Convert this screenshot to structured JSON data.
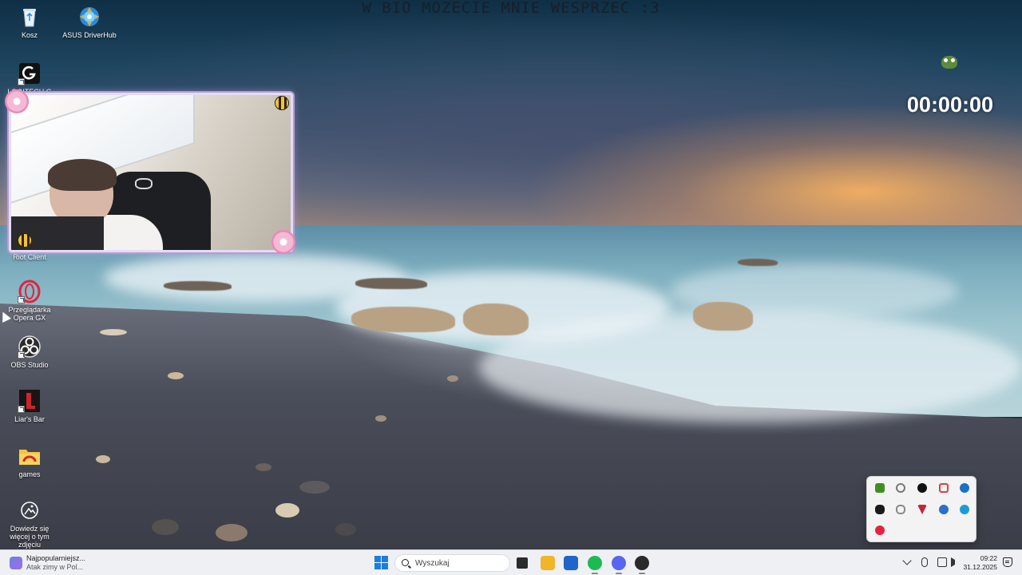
{
  "overlay": {
    "banner_text": "W BIO MOZECIE MNIE WESPRZEC :3",
    "timer": "00:00:00"
  },
  "desktop_icons": [
    {
      "label": "Kosz",
      "icon": "recycle-bin-icon"
    },
    {
      "label": "ASUS DriverHub",
      "icon": "asus-driverhub-icon"
    },
    {
      "label": "LOGITECH G HUB",
      "icon": "logitech-ghub-icon"
    },
    {
      "label": "Riot Client",
      "icon": "riot-client-icon"
    },
    {
      "label": "Przeglądarka Opera GX",
      "icon": "opera-gx-icon"
    },
    {
      "label": "OBS Studio",
      "icon": "obs-studio-icon"
    },
    {
      "label": "Liar's Bar",
      "icon": "liars-bar-icon"
    },
    {
      "label": "games",
      "icon": "folder-icon"
    },
    {
      "label": "Dowiedz się więcej o tym zdjęciu",
      "icon": "learn-about-picture-icon"
    }
  ],
  "taskbar": {
    "weather_title": "Najpopularniejsz...",
    "weather_subtitle": "Atak zimy w Pol...",
    "search_placeholder": "Wyszukaj",
    "time": "09:22",
    "date": "31.12.2025",
    "pinned_apps": [
      {
        "icon": "task-view-icon",
        "color": "#2b2b2b"
      },
      {
        "icon": "file-explorer-icon",
        "color": "#f1b52a"
      },
      {
        "icon": "microsoft-store-icon",
        "color": "#1f64c9"
      },
      {
        "icon": "spotify-icon",
        "color": "#1db954"
      },
      {
        "icon": "discord-icon",
        "color": "#5865f2"
      },
      {
        "icon": "riot-client-icon",
        "color": "#2a2a2a"
      }
    ]
  },
  "tray_flyout": {
    "items": [
      {
        "icon": "nvidia-icon",
        "color": "#3f8f1f"
      },
      {
        "icon": "steelseries-icon",
        "color": "#777777"
      },
      {
        "icon": "logitech-ghub-icon",
        "color": "#111111"
      },
      {
        "icon": "discord-tray-icon",
        "color": "#d14545"
      },
      {
        "icon": "onedrive-icon",
        "color": "#1b6fc6"
      },
      {
        "icon": "riot-vanguard-icon",
        "color": "#1a1a1a"
      },
      {
        "icon": "controller-icon",
        "color": "#888888"
      },
      {
        "icon": "vanguard-icon",
        "color": "#c0253a"
      },
      {
        "icon": "asus-icon",
        "color": "#2a6fc9"
      },
      {
        "icon": "edge-icon",
        "color": "#1e9bd7"
      },
      {
        "icon": "opera-gx-tray-icon",
        "color": "#e5233f"
      }
    ]
  }
}
